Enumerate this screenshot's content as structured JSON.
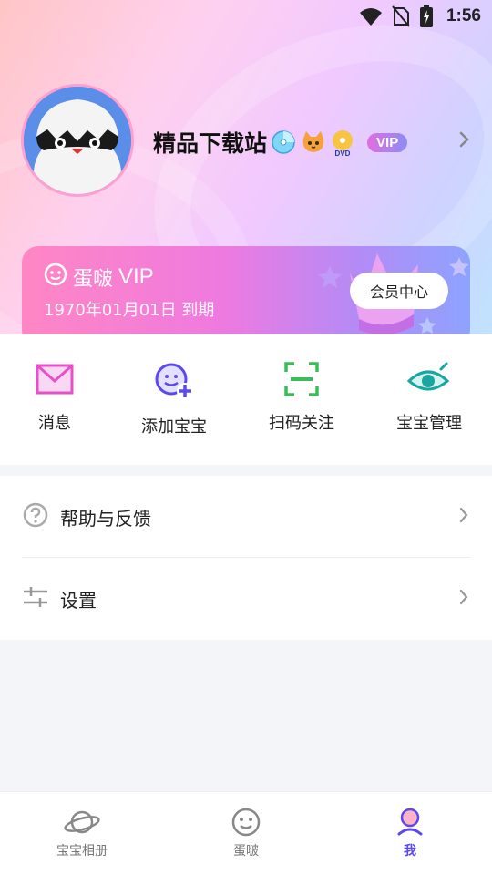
{
  "status_bar": {
    "time": "1:56",
    "icons": [
      "wifi-icon",
      "no-sim-icon",
      "battery-charging-icon"
    ]
  },
  "profile": {
    "name": "精品下载站",
    "badges": [
      "cd-icon",
      "cat-icon",
      "dvd-icon"
    ],
    "vip_badge": "VIP"
  },
  "vip_card": {
    "brand": "蛋啵",
    "vip": "VIP",
    "expire": "1970年01月01日 到期",
    "center_button": "会员中心"
  },
  "quick_actions": [
    {
      "label": "消息",
      "icon": "mail-icon",
      "color": "#e84fc9"
    },
    {
      "label": "添加宝宝",
      "icon": "add-baby-icon",
      "color": "#5b49f0"
    },
    {
      "label": "扫码关注",
      "icon": "scan-icon",
      "color": "#3dbb5a"
    },
    {
      "label": "宝宝管理",
      "icon": "eye-icon",
      "color": "#1aa5a0"
    }
  ],
  "menu": [
    {
      "label": "帮助与反馈",
      "icon": "help-icon"
    },
    {
      "label": "设置",
      "icon": "settings-sliders-icon"
    }
  ],
  "tabs": [
    {
      "label": "宝宝相册",
      "icon": "planet-icon",
      "active": false
    },
    {
      "label": "蛋啵",
      "icon": "smile-face-icon",
      "active": false
    },
    {
      "label": "我",
      "icon": "profile-icon",
      "active": true
    }
  ],
  "colors": {
    "accent": "#5b49f0",
    "vip_pink": "#ff86c4",
    "vip_purple": "#8da3ff"
  }
}
